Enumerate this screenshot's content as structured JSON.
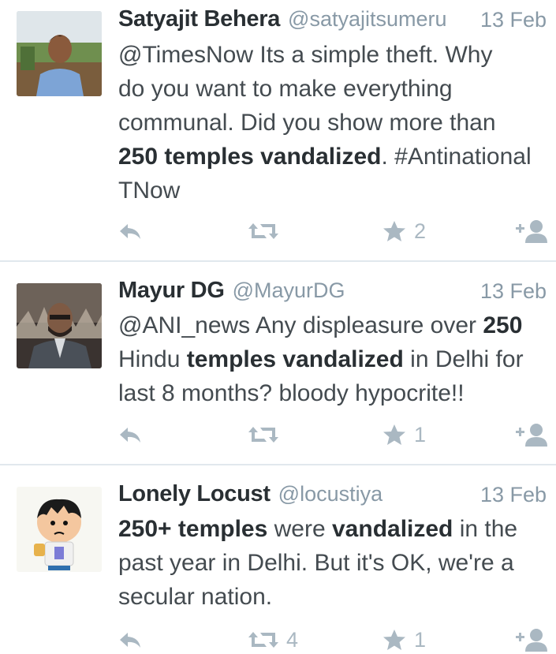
{
  "tweets": [
    {
      "name": "Satyajit Behera",
      "handle": "@satyajitsumeru",
      "time": "13 Feb",
      "body": [
        "@TimesNow Its a simple theft. Why",
        "do you want to make everything",
        "communal. Did you show more than",
        "__250 temples vandalized__. #Antinational",
        "TNow"
      ],
      "retweets": "",
      "favorites": "2"
    },
    {
      "name": "Mayur DG",
      "handle": "@MayurDG",
      "time": "13 Feb",
      "body": [
        "@ANI_news Any displeasure over __250__",
        "Hindu __temples vandalized__ in Delhi for",
        "last 8 months? bloody hypocrite!!"
      ],
      "retweets": "",
      "favorites": "1"
    },
    {
      "name": "Lonely Locust",
      "handle": "@locustiya",
      "time": "13 Feb",
      "body": [
        "__250+ temples__ were __vandalized__ in the",
        "past year in Delhi. But it's OK, we're a",
        "secular nation."
      ],
      "retweets": "4",
      "favorites": "1"
    }
  ],
  "colors": {
    "text": "#292f33",
    "muted": "#8899a6",
    "icon": "#aab8c2",
    "divider": "#e1e8ed"
  },
  "icons": [
    "reply-icon",
    "retweet-icon",
    "favorite-icon",
    "follow-icon"
  ]
}
